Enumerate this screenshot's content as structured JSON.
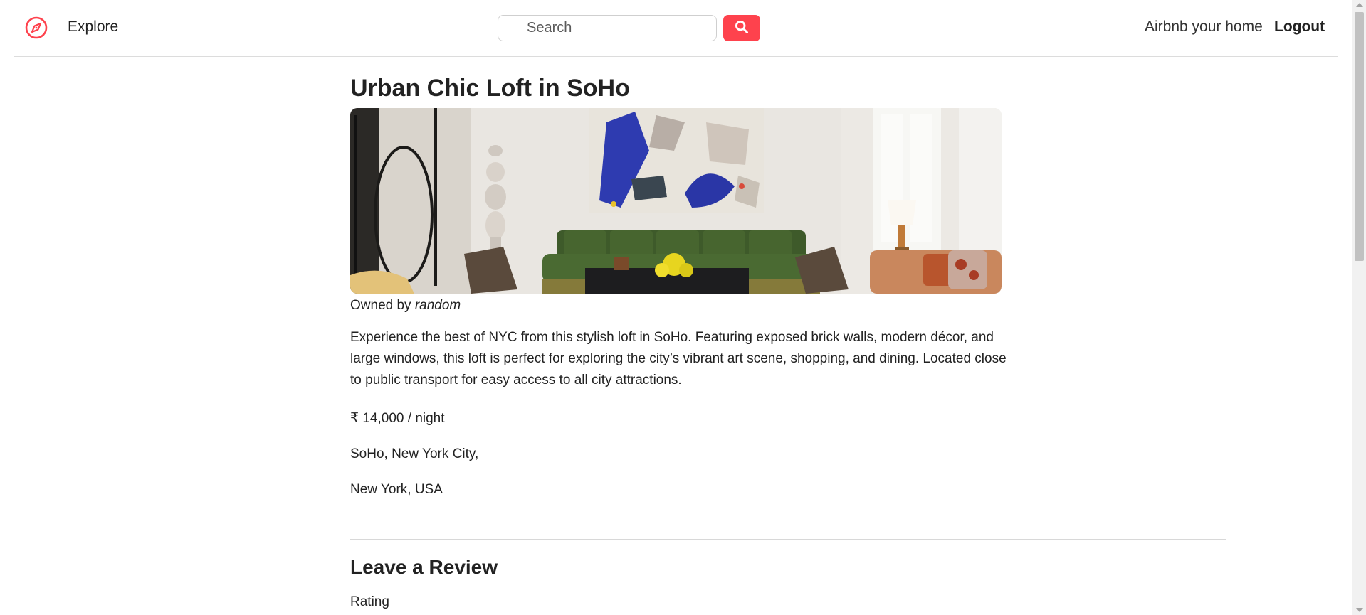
{
  "nav": {
    "explore_label": "Explore",
    "search_placeholder": "Search",
    "host_label": "Airbnb your home",
    "logout_label": "Logout",
    "brand_icon": "compass-icon",
    "search_icon": "search-icon",
    "accent_color": "#fe424d"
  },
  "listing": {
    "title": "Urban Chic Loft in SoHo",
    "owner_prefix": "Owned by",
    "owner_name": "random",
    "description": "Experience the best of NYC from this stylish loft in SoHo. Featuring exposed brick walls, modern décor, and large windows, this loft is perfect for exploring the city’s vibrant art scene, shopping, and dining. Located close to public transport for easy access to all city attractions.",
    "price": "₹ 14,000 / night",
    "location": "SoHo, New York City,",
    "country": "New York, USA"
  },
  "review": {
    "title": "Leave a Review",
    "rating_label": "Rating"
  }
}
